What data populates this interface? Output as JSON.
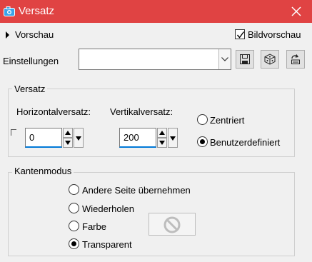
{
  "window": {
    "title": "Versatz",
    "icon": "camera-icon",
    "close_icon": "close-icon",
    "accent": "#e04343"
  },
  "preview": {
    "label": "Vorschau",
    "bildvorschau_label": "Bildvorschau",
    "bildvorschau_checked": true
  },
  "settings": {
    "label": "Einstellungen",
    "value": "",
    "buttons": [
      "save-icon",
      "dice-icon",
      "reset-icon"
    ]
  },
  "versatz": {
    "title": "Versatz",
    "horizontal_label": "Horizontalversatz:",
    "horizontal_value": "0",
    "vertical_label": "Vertikalversatz:",
    "vertical_value": "200",
    "options": [
      {
        "label": "Zentriert",
        "checked": false
      },
      {
        "label": "Benutzerdefiniert",
        "checked": true
      }
    ]
  },
  "kanten": {
    "title": "Kantenmodus",
    "options": [
      {
        "label": "Andere Seite übernehmen",
        "checked": false
      },
      {
        "label": "Wiederholen",
        "checked": false
      },
      {
        "label": "Farbe",
        "checked": false
      },
      {
        "label": "Transparent",
        "checked": true
      }
    ],
    "color_swatch_icon": "no-color-icon"
  }
}
